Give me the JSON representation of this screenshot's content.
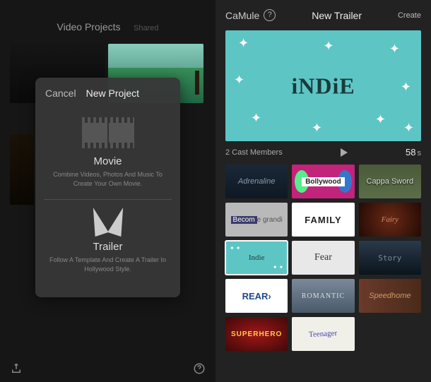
{
  "left": {
    "header_title": "Video Projects",
    "header_sub": "Shared",
    "modal": {
      "cancel": "Cancel",
      "title": "New Project",
      "movie_label": "Movie",
      "movie_desc": "Combine Videos, Photos And Music To Create Your Own Movie.",
      "trailer_label": "Trailer",
      "trailer_desc": "Follow A Template And Create A Trailer In Hollywood Style."
    }
  },
  "right": {
    "back": "CaMule",
    "title": "New Trailer",
    "create": "Create",
    "preview_title": "iNDiE",
    "cast_members": "2 Cast Members",
    "duration_value": "58",
    "duration_unit": "s",
    "templates": [
      {
        "id": "adrenaline",
        "label": "Adrenaline"
      },
      {
        "id": "bollywood",
        "label": "Bollywood"
      },
      {
        "id": "sword",
        "label": "Cappa Sword"
      },
      {
        "id": "become",
        "label": "Become grandi"
      },
      {
        "id": "family",
        "label": "FAMILY"
      },
      {
        "id": "fairy",
        "label": "Fairy"
      },
      {
        "id": "indie",
        "label": "Indie"
      },
      {
        "id": "fear",
        "label": "Fear"
      },
      {
        "id": "story",
        "label": "Story"
      },
      {
        "id": "rear",
        "label": "REAR›"
      },
      {
        "id": "romantic",
        "label": "ROMANTIC"
      },
      {
        "id": "speed",
        "label": "Speedhome"
      },
      {
        "id": "super",
        "label": "SUPERHERO"
      },
      {
        "id": "teen",
        "label": "Teenager"
      }
    ],
    "selected_template": "indie"
  }
}
